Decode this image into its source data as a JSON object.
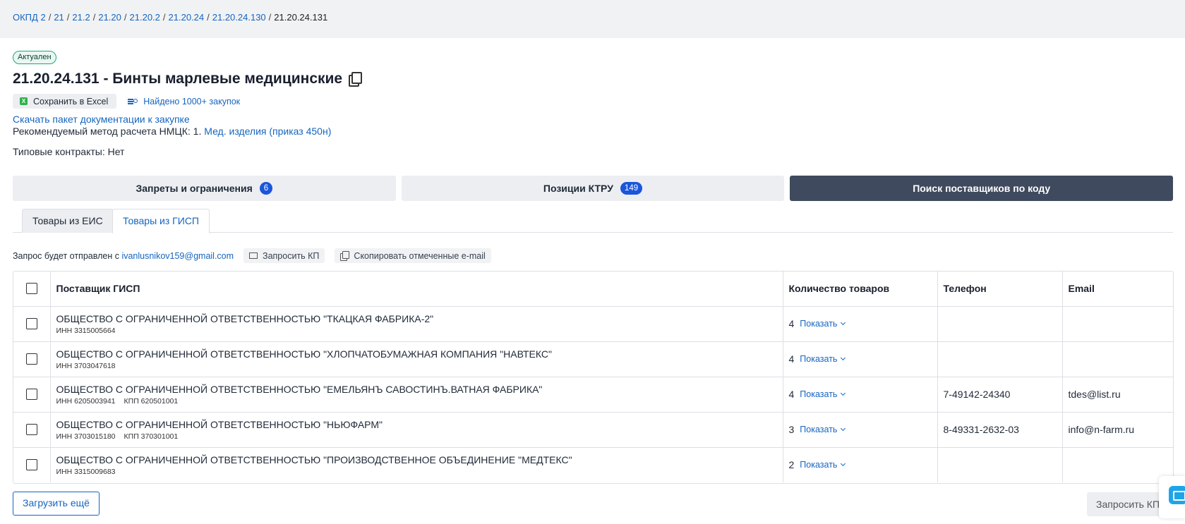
{
  "breadcrumb": {
    "items": [
      "ОКПД 2",
      "21",
      "21.2",
      "21.20",
      "21.20.2",
      "21.20.24",
      "21.20.24.130"
    ],
    "current": "21.20.24.131",
    "separator": "/"
  },
  "status_badge": "Актуален",
  "page_title": "21.20.24.131 - Бинты марлевые медицинские",
  "actions": {
    "excel_label": "Сохранить в Excel",
    "excel_icon": "X",
    "found_label": "Найдено 1000+ закупок"
  },
  "doc_link": "Скачать пакет документации к закупке",
  "nmck": {
    "label": "Рекомендуемый метод расчета НМЦК: 1.",
    "link": "Мед. изделия (приказ 450н)"
  },
  "typical_contracts": "Типовые контракты: Нет",
  "big_tabs": [
    {
      "label": "Запреты и ограничения",
      "count": "6"
    },
    {
      "label": "Позиции КТРУ",
      "count": "149"
    },
    {
      "label": "Поиск поставщиков по коду",
      "count": ""
    }
  ],
  "sub_tabs": [
    {
      "label": "Товары из ЕИС"
    },
    {
      "label": "Товары из ГИСП"
    }
  ],
  "request": {
    "text": "Запрос будет отправлен с",
    "email": "ivanlusnikov159@gmail.com",
    "request_kp_label": "Запросить КП",
    "copy_emails_label": "Скопировать отмеченные e-mail"
  },
  "table": {
    "headers": [
      "Поставщик ГИСП",
      "Количество товаров",
      "Телефон",
      "Email"
    ],
    "show_label": "Показать",
    "rows": [
      {
        "name": "ОБЩЕСТВО С ОГРАНИЧЕННОЙ ОТВЕТСТВЕННОСТЬЮ \"ТКАЦКАЯ ФАБРИКА-2\"",
        "inn": "ИНН 3315005664",
        "kpp": "",
        "qty": "4",
        "phone": "",
        "email": ""
      },
      {
        "name": "ОБЩЕСТВО С ОГРАНИЧЕННОЙ ОТВЕТСТВЕННОСТЬЮ \"ХЛОПЧАТОБУМАЖНАЯ КОМПАНИЯ \"НАВТЕКС\"",
        "inn": "ИНН 3703047618",
        "kpp": "",
        "qty": "4",
        "phone": "",
        "email": ""
      },
      {
        "name": "ОБЩЕСТВО С ОГРАНИЧЕННОЙ ОТВЕТСТВЕННОСТЬЮ \"ЕМЕЛЬЯНЪ САВОСТИНЪ.ВАТНАЯ ФАБРИКА\"",
        "inn": "ИНН 6205003941",
        "kpp": "КПП 620501001",
        "qty": "4",
        "phone": "7-49142-24340",
        "email": "tdes@list.ru"
      },
      {
        "name": "ОБЩЕСТВО С ОГРАНИЧЕННОЙ ОТВЕТСТВЕННОСТЬЮ \"НЬЮФАРМ\"",
        "inn": "ИНН 3703015180",
        "kpp": "КПП 370301001",
        "qty": "3",
        "phone": "8-49331-2632-03",
        "email": "info@n-farm.ru"
      },
      {
        "name": "ОБЩЕСТВО С ОГРАНИЧЕННОЙ ОТВЕТСТВЕННОСТЬЮ \"ПРОИЗВОДСТВЕННОЕ ОБЪЕДИНЕНИЕ \"МЕДТЕКС\"",
        "inn": "ИНН 3315009683",
        "kpp": "",
        "qty": "2",
        "phone": "",
        "email": ""
      }
    ]
  },
  "load_more_label": "Загрузить ещё",
  "request_kp_bottom_label": "Запросить КП",
  "icons": {
    "copy": "copy-icon",
    "excel": "excel-icon",
    "found": "list-search-icon",
    "mail": "mail-icon",
    "chevron": "chevron-down-icon",
    "chat": "chat-icon"
  },
  "colors": {
    "accent": "#1565c0",
    "badge_blue": "#1a56db",
    "dark_tab": "#3f4a5e",
    "status_green": "#19a974"
  }
}
